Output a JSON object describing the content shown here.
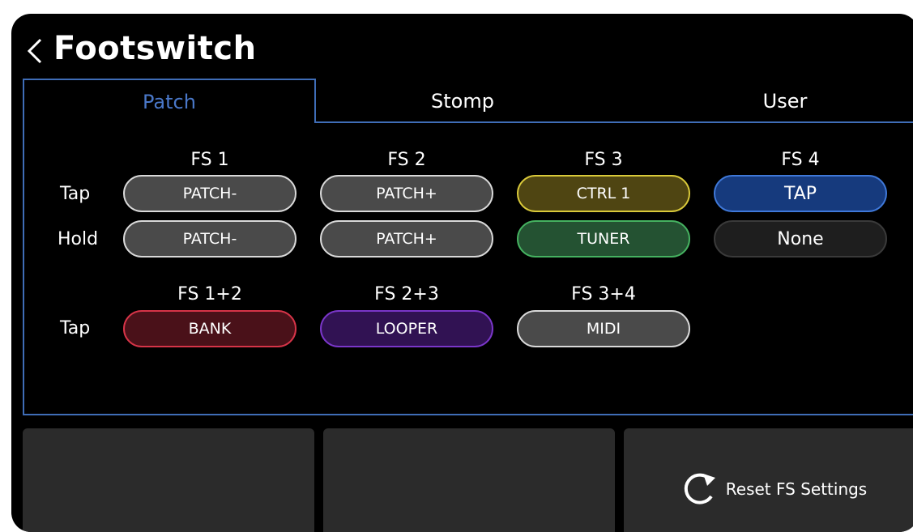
{
  "header": {
    "title": "Footswitch"
  },
  "tabs": [
    {
      "label": "Patch"
    },
    {
      "label": "Stomp"
    },
    {
      "label": "User"
    }
  ],
  "columns": [
    "FS 1",
    "FS 2",
    "FS 3",
    "FS 4"
  ],
  "rows": {
    "tap": "Tap",
    "hold": "Hold"
  },
  "tap_buttons": [
    {
      "label": "PATCH-",
      "color": "#4a4a4a",
      "border": "#d9d9d9"
    },
    {
      "label": "PATCH+",
      "color": "#4a4a4a",
      "border": "#d9d9d9"
    },
    {
      "label": "CTRL 1",
      "color": "#4f4512",
      "border": "#d9c93a"
    },
    {
      "label": "TAP",
      "color": "#163a7d",
      "border": "#3f78d8"
    }
  ],
  "hold_buttons": [
    {
      "label": "PATCH-",
      "color": "#4a4a4a",
      "border": "#d9d9d9"
    },
    {
      "label": "PATCH+",
      "color": "#4a4a4a",
      "border": "#d9d9d9"
    },
    {
      "label": "TUNER",
      "color": "#245232",
      "border": "#45b160"
    },
    {
      "label": "None",
      "color": "#1e1e1e",
      "border": "#3a3a3a"
    }
  ],
  "combo_columns": [
    "FS 1+2",
    "FS 2+3",
    "FS 3+4"
  ],
  "combo_row": {
    "tap": "Tap"
  },
  "combo_buttons": [
    {
      "label": "BANK",
      "color": "#4a1119",
      "border": "#d63448"
    },
    {
      "label": "LOOPER",
      "color": "#311253",
      "border": "#7a36c9"
    },
    {
      "label": "MIDI",
      "color": "#4a4a4a",
      "border": "#d9d9d9"
    }
  ],
  "bottom": {
    "reset_label": "Reset FS Settings"
  }
}
